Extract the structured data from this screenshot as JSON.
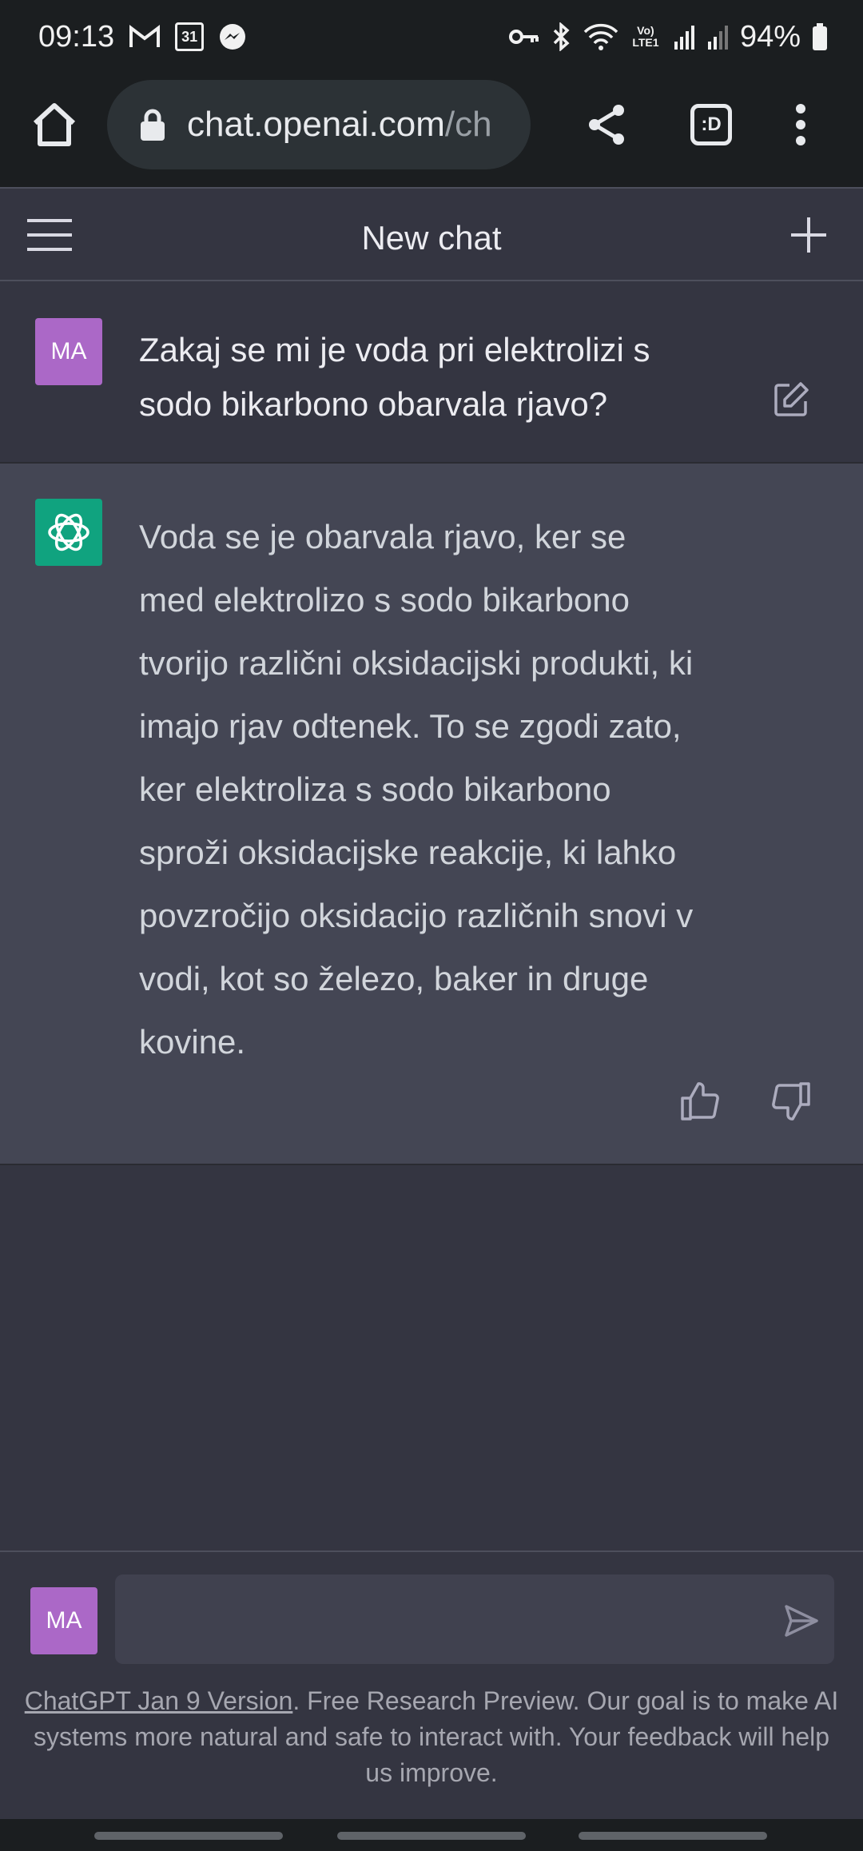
{
  "status_bar": {
    "time": "09:13",
    "battery": "94%",
    "notification_icons": [
      "gmail-icon",
      "calendar-icon",
      "messenger-icon"
    ],
    "calendar_day": "31",
    "system_icons": [
      "vpn-key-icon",
      "bluetooth-icon",
      "wifi-icon",
      "volte-icon",
      "signal-icon",
      "signal-icon",
      "battery-icon"
    ],
    "volte_label": "Vo) LTE1"
  },
  "browser": {
    "url_domain": "chat.openai.com",
    "url_path": "/ch",
    "tabs_label": ":D"
  },
  "header": {
    "title": "New chat"
  },
  "messages": {
    "user_avatar": "MA",
    "user_text": "Zakaj se mi je voda pri elektrolizi s sodo bikarbono obarvala rjavo?",
    "assistant_text": "Voda se je obarvala rjavo, ker se med elektrolizo s sodo bikarbono tvorijo različni oksidacijski produkti, ki imajo rjav odtenek. To se zgodi zato, ker elektroliza s sodo bikarbono sproži oksidacijske reakcije, ki lahko povzročijo oksidacijo različnih snovi v vodi, kot so železo, baker in druge kovine."
  },
  "composer": {
    "avatar": "MA",
    "value": "",
    "placeholder": ""
  },
  "footer": {
    "version_link": "ChatGPT Jan 9 Version",
    "note": ". Free Research Preview. Our goal is to make AI systems more natural and safe to interact with. Your feedback will help us improve."
  },
  "colors": {
    "background": "#343541",
    "assistant_bg": "#444654",
    "user_avatar": "#ab68c7",
    "assistant_avatar": "#10a37f",
    "browser_chrome": "#1b1e20"
  }
}
